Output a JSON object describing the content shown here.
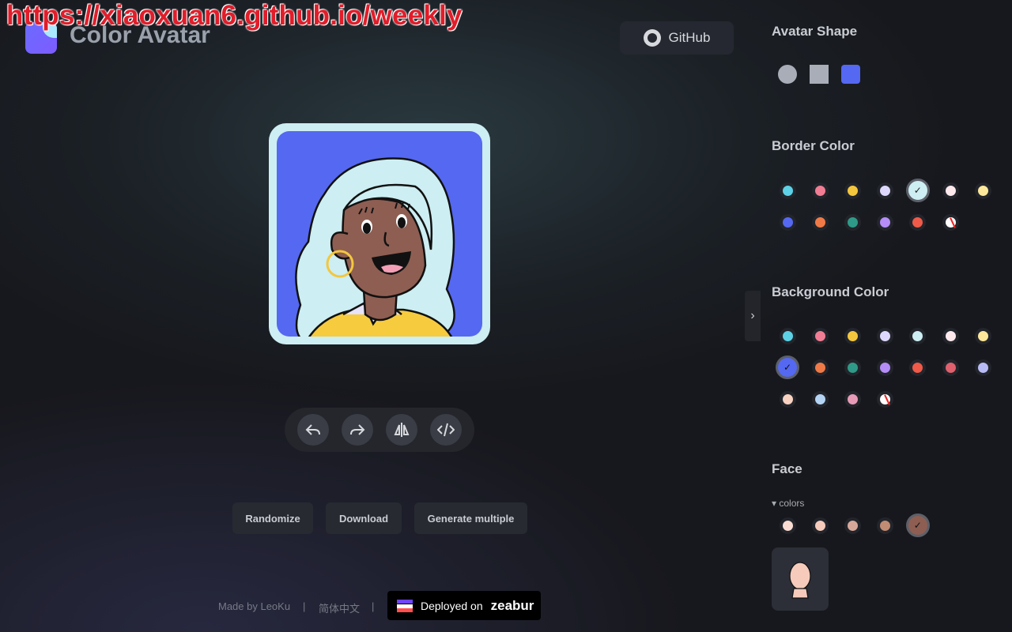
{
  "watermark": "https://xiaoxuan6.github.io/weekly",
  "header": {
    "title": "Color Avatar",
    "github_label": "GitHub"
  },
  "toolbar": {
    "icons": [
      "undo-icon",
      "redo-icon",
      "flip-icon",
      "code-icon"
    ]
  },
  "actions": {
    "randomize": "Randomize",
    "download": "Download",
    "generate_multiple": "Generate multiple"
  },
  "footer": {
    "made_by": "Made by LeoKu",
    "sep": "|",
    "lang": "简体中文",
    "deploy_prefix": "Deployed on",
    "deploy_brand": "zeabur"
  },
  "panel": {
    "avatar_shape": {
      "title": "Avatar Shape",
      "options": [
        "circle",
        "square",
        "squircle"
      ],
      "selected": "squircle"
    },
    "border_color": {
      "title": "Border Color",
      "colors": [
        "#5dd1e6",
        "#f07d93",
        "#f3c73d",
        "#ddd8fb",
        "#cdeef2",
        "#fde9ec",
        "#fde79a",
        "#5568f1",
        "#f07a47",
        "#2f9a88",
        "#b48df6",
        "#f05a48",
        "none"
      ],
      "selected": "#cdeef2"
    },
    "background_color": {
      "title": "Background Color",
      "colors": [
        "#5dd1e6",
        "#f07d93",
        "#f3c73d",
        "#ddd8fb",
        "#cdeef2",
        "#fde9ec",
        "#fde79a",
        "#5568f1",
        "#f07a47",
        "#2f9a88",
        "#b48df6",
        "#f05a48",
        "#e0606e",
        "#b7bcf6",
        "#f9d2c1",
        "#b4d4f4",
        "#e89bb6",
        "none"
      ],
      "selected": "#5568f1"
    },
    "face": {
      "title": "Face",
      "colors_label": "colors",
      "colors": [
        "#f9ddd3",
        "#f6cbbb",
        "#d7a89a",
        "#c28b74",
        "#8e5e52"
      ],
      "selected": "#8e5e52"
    }
  }
}
